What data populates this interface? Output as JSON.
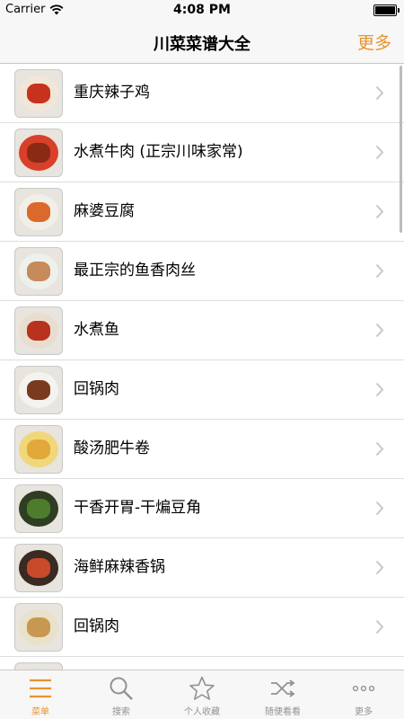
{
  "status_bar": {
    "carrier": "Carrier",
    "time": "4:08 PM"
  },
  "nav": {
    "title": "川菜菜谱大全",
    "more": "更多"
  },
  "recipes": [
    {
      "name": "重庆辣子鸡",
      "plate": "#f3e6d8",
      "food": "#c8321c"
    },
    {
      "name": "水煮牛肉 (正宗川味家常)",
      "plate": "#d8402a",
      "food": "#8a2a14"
    },
    {
      "name": "麻婆豆腐",
      "plate": "#f2efe8",
      "food": "#d96a2c"
    },
    {
      "name": "最正宗的鱼香肉丝",
      "plate": "#eef0ec",
      "food": "#c78a5a"
    },
    {
      "name": "水煮鱼",
      "plate": "#e9ddd0",
      "food": "#b8321e"
    },
    {
      "name": "回锅肉",
      "plate": "#f5f3ef",
      "food": "#7a3a20"
    },
    {
      "name": "酸汤肥牛卷",
      "plate": "#f0d77a",
      "food": "#e2a83a"
    },
    {
      "name": "干香开胃-干煸豆角",
      "plate": "#2f3d22",
      "food": "#4d7d2c"
    },
    {
      "name": "海鲜麻辣香锅",
      "plate": "#3a2a22",
      "food": "#c84a2a"
    },
    {
      "name": "回锅肉",
      "plate": "#e9e1c9",
      "food": "#c89850"
    },
    {
      "name": "",
      "plate": "#d7e3d0",
      "food": "#6a9a3c"
    }
  ],
  "tabs": [
    {
      "label": "菜单",
      "icon": "menu-icon",
      "active": true
    },
    {
      "label": "搜索",
      "icon": "search-icon",
      "active": false
    },
    {
      "label": "个人收藏",
      "icon": "star-icon",
      "active": false
    },
    {
      "label": "随便看看",
      "icon": "shuffle-icon",
      "active": false
    },
    {
      "label": "更多",
      "icon": "more-icon",
      "active": false
    }
  ],
  "colors": {
    "accent": "#e8932d",
    "inactive": "#929292",
    "bar": "#f7f7f7"
  }
}
